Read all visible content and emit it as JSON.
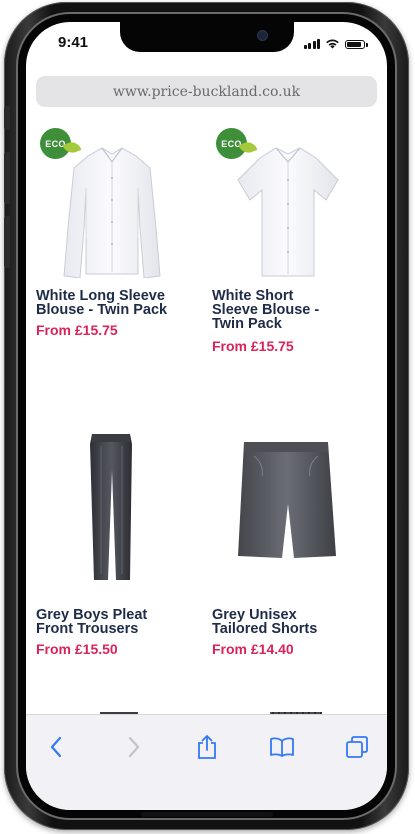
{
  "status_bar": {
    "time": "9:41"
  },
  "browser": {
    "url": "www.price-buckland.co.uk"
  },
  "products": [
    {
      "name_lines": [
        "White Long Sleeve",
        "Blouse - Twin Pack"
      ],
      "price": "From £15.75",
      "badge": "ECO",
      "image_icon": "long-sleeve-blouse-image"
    },
    {
      "name_lines": [
        "White Short",
        "Sleeve Blouse -",
        "Twin Pack"
      ],
      "price": "From £15.75",
      "badge": "ECO",
      "image_icon": "short-sleeve-blouse-image"
    },
    {
      "name_lines": [
        "Grey Boys Pleat",
        "Front Trousers"
      ],
      "price": "From £15.50",
      "image_icon": "grey-trousers-image"
    },
    {
      "name_lines": [
        "Grey Unisex",
        "Tailored Shorts"
      ],
      "price": "From £14.40",
      "image_icon": "grey-shorts-image"
    }
  ],
  "toolbar": {
    "items": [
      "back-icon",
      "forward-icon",
      "share-icon",
      "bookmarks-icon",
      "tabs-icon"
    ]
  },
  "colors": {
    "product_name": "#1f2c48",
    "price": "#d8245a",
    "eco_badge": "#3f8f3a",
    "toolbar_icon": "#3478f6"
  }
}
